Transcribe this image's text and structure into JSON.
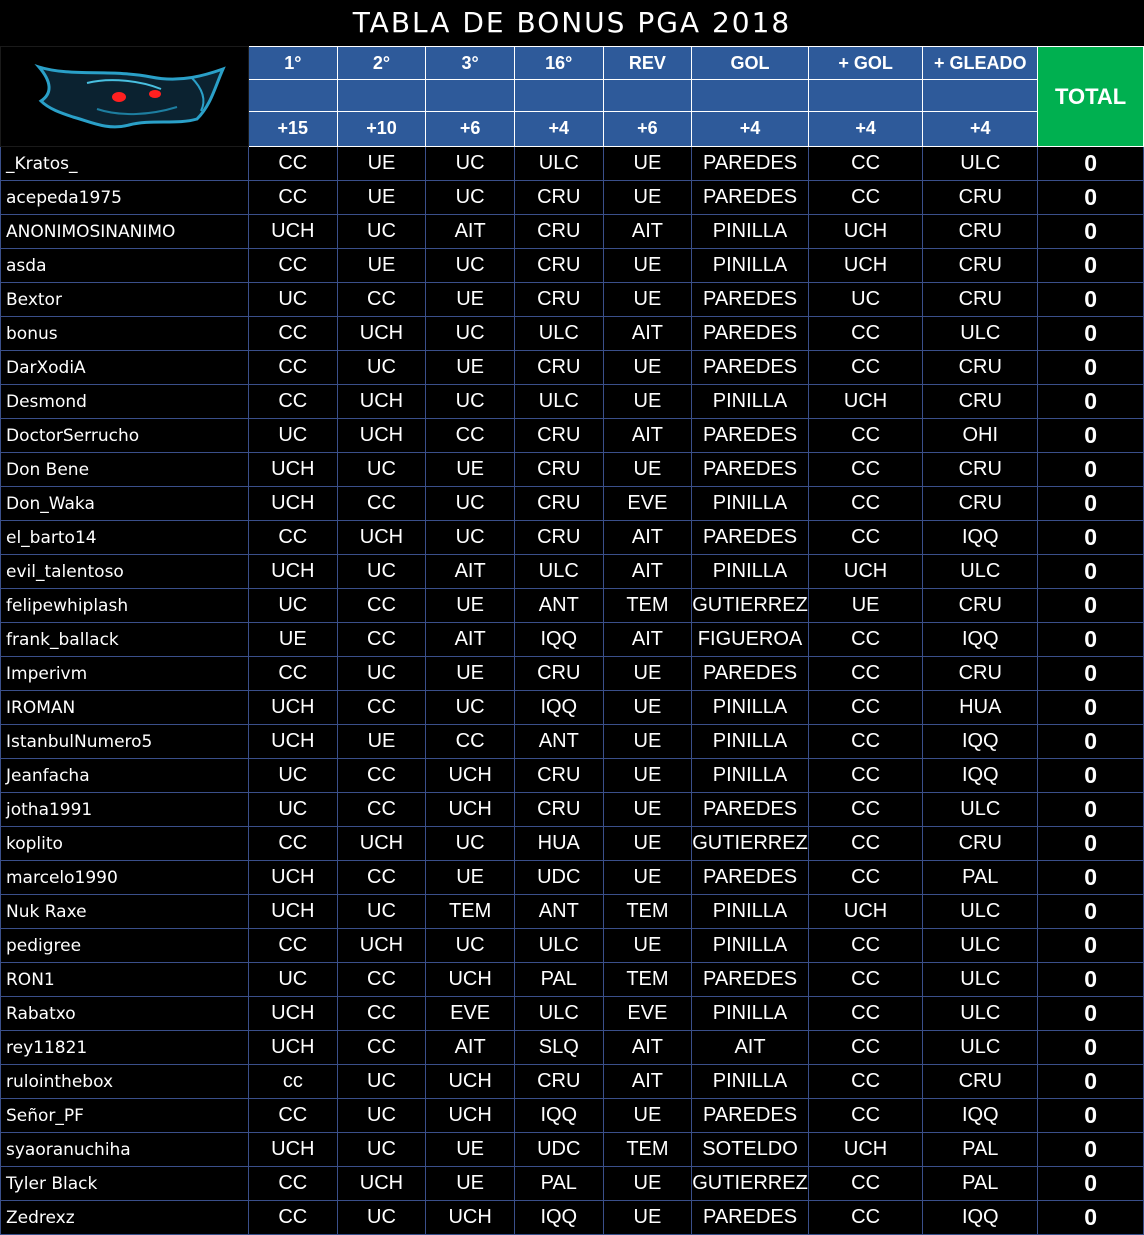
{
  "title": "TABLA DE BONUS PGA  2018",
  "columns": [
    {
      "label": "1°",
      "points": "+15"
    },
    {
      "label": "2°",
      "points": "+10"
    },
    {
      "label": "3°",
      "points": "+6"
    },
    {
      "label": "16°",
      "points": "+4"
    },
    {
      "label": "REV",
      "points": "+6"
    },
    {
      "label": "GOL",
      "points": "+4"
    },
    {
      "label": "+ GOL",
      "points": "+4"
    },
    {
      "label": "+ GLEADO",
      "points": "+4"
    }
  ],
  "total_label": "TOTAL",
  "logo_icon": "red-eyed-creature-logo",
  "colors": {
    "header_blue": "#2e5a9a",
    "total_green": "#00b050",
    "grid_line": "#3a4f8a"
  },
  "rows": [
    {
      "name": "_Kratos_",
      "picks": [
        "CC",
        "UE",
        "UC",
        "ULC",
        "UE",
        "PAREDES",
        "CC",
        "ULC"
      ],
      "total": "0"
    },
    {
      "name": "acepeda1975",
      "picks": [
        "CC",
        "UE",
        "UC",
        "CRU",
        "UE",
        "PAREDES",
        "CC",
        "CRU"
      ],
      "total": "0"
    },
    {
      "name": "ANONIMOSINANIMO",
      "picks": [
        "UCH",
        "UC",
        "AIT",
        "CRU",
        "AIT",
        "PINILLA",
        "UCH",
        "CRU"
      ],
      "total": "0"
    },
    {
      "name": "asda",
      "picks": [
        "CC",
        "UE",
        "UC",
        "CRU",
        "UE",
        "PINILLA",
        "UCH",
        "CRU"
      ],
      "total": "0"
    },
    {
      "name": "Bextor",
      "picks": [
        "UC",
        "CC",
        "UE",
        "CRU",
        "UE",
        "PAREDES",
        "UC",
        "CRU"
      ],
      "total": "0"
    },
    {
      "name": "bonus",
      "picks": [
        "CC",
        "UCH",
        "UC",
        "ULC",
        "AIT",
        "PAREDES",
        "CC",
        "ULC"
      ],
      "total": "0"
    },
    {
      "name": "DarXodiA",
      "picks": [
        "CC",
        "UC",
        "UE",
        "CRU",
        "UE",
        "PAREDES",
        "CC",
        "CRU"
      ],
      "total": "0"
    },
    {
      "name": "Desmond",
      "picks": [
        "CC",
        "UCH",
        "UC",
        "ULC",
        "UE",
        "PINILLA",
        "UCH",
        "CRU"
      ],
      "total": "0"
    },
    {
      "name": "DoctorSerrucho",
      "picks": [
        "UC",
        "UCH",
        "CC",
        "CRU",
        "AIT",
        "PAREDES",
        "CC",
        "OHI"
      ],
      "total": "0"
    },
    {
      "name": "Don Bene",
      "picks": [
        "UCH",
        "UC",
        "UE",
        "CRU",
        "UE",
        "PAREDES",
        "CC",
        "CRU"
      ],
      "total": "0"
    },
    {
      "name": "Don_Waka",
      "picks": [
        "UCH",
        "CC",
        "UC",
        "CRU",
        "EVE",
        "PINILLA",
        "CC",
        "CRU"
      ],
      "total": "0"
    },
    {
      "name": "el_barto14",
      "picks": [
        "CC",
        "UCH",
        "UC",
        "CRU",
        "AIT",
        "PAREDES",
        "CC",
        "IQQ"
      ],
      "total": "0"
    },
    {
      "name": "evil_talentoso",
      "picks": [
        "UCH",
        "UC",
        "AIT",
        "ULC",
        "AIT",
        "PINILLA",
        "UCH",
        "ULC"
      ],
      "total": "0"
    },
    {
      "name": "felipewhiplash",
      "picks": [
        "UC",
        "CC",
        "UE",
        "ANT",
        "TEM",
        "GUTIERREZ",
        "UE",
        "CRU"
      ],
      "total": "0"
    },
    {
      "name": "frank_ballack",
      "picks": [
        "UE",
        "CC",
        "AIT",
        "IQQ",
        "AIT",
        "FIGUEROA",
        "CC",
        "IQQ"
      ],
      "total": "0"
    },
    {
      "name": "Imperivm",
      "picks": [
        "CC",
        "UC",
        "UE",
        "CRU",
        "UE",
        "PAREDES",
        "CC",
        "CRU"
      ],
      "total": "0"
    },
    {
      "name": "IROMAN",
      "picks": [
        "UCH",
        "CC",
        "UC",
        "IQQ",
        "UE",
        "PINILLA",
        "CC",
        "HUA"
      ],
      "total": "0"
    },
    {
      "name": "IstanbulNumero5",
      "picks": [
        "UCH",
        "UE",
        "CC",
        "ANT",
        "UE",
        "PINILLA",
        "CC",
        "IQQ"
      ],
      "total": "0"
    },
    {
      "name": "Jeanfacha",
      "picks": [
        "UC",
        "CC",
        "UCH",
        "CRU",
        "UE",
        "PINILLA",
        "CC",
        "IQQ"
      ],
      "total": "0"
    },
    {
      "name": "jotha1991",
      "picks": [
        "UC",
        "CC",
        "UCH",
        "CRU",
        "UE",
        "PAREDES",
        "CC",
        "ULC"
      ],
      "total": "0"
    },
    {
      "name": "koplito",
      "picks": [
        "CC",
        "UCH",
        "UC",
        "HUA",
        "UE",
        "GUTIERREZ",
        "CC",
        "CRU"
      ],
      "total": "0"
    },
    {
      "name": "marcelo1990",
      "picks": [
        "UCH",
        "CC",
        "UE",
        "UDC",
        "UE",
        "PAREDES",
        "CC",
        "PAL"
      ],
      "total": "0"
    },
    {
      "name": "Nuk Raxe",
      "picks": [
        "UCH",
        "UC",
        "TEM",
        "ANT",
        "TEM",
        "PINILLA",
        "UCH",
        "ULC"
      ],
      "total": "0"
    },
    {
      "name": "pedigree",
      "picks": [
        "CC",
        "UCH",
        "UC",
        "ULC",
        "UE",
        "PINILLA",
        "CC",
        "ULC"
      ],
      "total": "0"
    },
    {
      "name": "RON1",
      "picks": [
        "UC",
        "CC",
        "UCH",
        "PAL",
        "TEM",
        "PAREDES",
        "CC",
        "ULC"
      ],
      "total": "0"
    },
    {
      "name": "Rabatxo",
      "picks": [
        "UCH",
        "CC",
        "EVE",
        "ULC",
        "EVE",
        "PINILLA",
        "CC",
        "ULC"
      ],
      "total": "0"
    },
    {
      "name": "rey11821",
      "picks": [
        "UCH",
        "CC",
        "AIT",
        "SLQ",
        "AIT",
        "AIT",
        "CC",
        "ULC"
      ],
      "total": "0"
    },
    {
      "name": "rulointhebox",
      "picks": [
        "cc",
        "UC",
        "UCH",
        "CRU",
        "AIT",
        "PINILLA",
        "CC",
        "CRU"
      ],
      "total": "0"
    },
    {
      "name": "Señor_PF",
      "picks": [
        "CC",
        "UC",
        "UCH",
        "IQQ",
        "UE",
        "PAREDES",
        "CC",
        "IQQ"
      ],
      "total": "0"
    },
    {
      "name": "syaoranuchiha",
      "picks": [
        "UCH",
        "UC",
        "UE",
        "UDC",
        "TEM",
        "SOTELDO",
        "UCH",
        "PAL"
      ],
      "total": "0"
    },
    {
      "name": "Tyler Black",
      "picks": [
        "CC",
        "UCH",
        "UE",
        "PAL",
        "UE",
        "GUTIERREZ",
        "CC",
        "PAL"
      ],
      "total": "0"
    },
    {
      "name": "Zedrexz",
      "picks": [
        "CC",
        "UC",
        "UCH",
        "IQQ",
        "UE",
        "PAREDES",
        "CC",
        "IQQ"
      ],
      "total": "0"
    }
  ]
}
